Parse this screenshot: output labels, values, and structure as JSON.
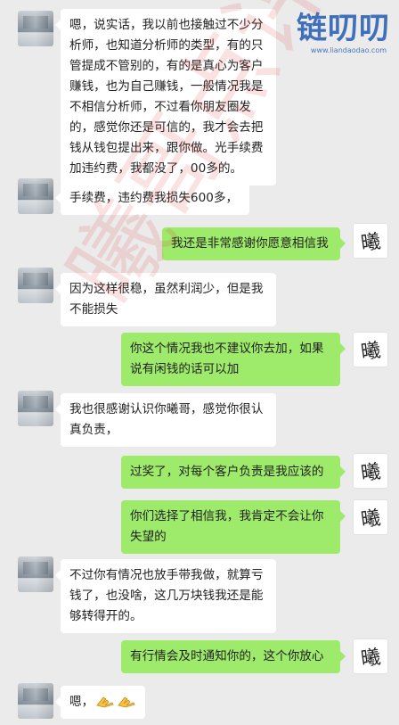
{
  "watermark": {
    "logo_text": "链叨叨",
    "logo_url": "www.liandaodao.com",
    "stamp_text": "曦哥点评"
  },
  "avatars": {
    "right_label": "曦"
  },
  "messages": [
    {
      "side": "left",
      "text": "嗯，说实话，我以前也接触过不少分析师，也知道分析师的类型，有的只管提成不管别的，有的是真心为客户赚钱，也为自己赚钱，一般情况我是不相信分析师，不过看你朋友圈发的，感觉你还是可信的，我才会去把钱从钱包提出来，跟你做。光手续费加违约费，我都没了，00多的。"
    },
    {
      "side": "left",
      "text": "手续费，违约费我损失600多，"
    },
    {
      "side": "right",
      "text": "我还是非常感谢你愿意相信我"
    },
    {
      "side": "left",
      "text": "因为这样很稳，虽然利润少，但是我不能损失"
    },
    {
      "side": "right",
      "text": "你这个情况我也不建议你去加，如果说有闲钱的话可以加"
    },
    {
      "side": "left",
      "text": "我也很感谢认识你曦哥，感觉你很认真负责，"
    },
    {
      "side": "right",
      "text": "过奖了，对每个客户负责是我应该的"
    },
    {
      "side": "right",
      "text": "你们选择了相信我，我肯定不会让你失望的"
    },
    {
      "side": "left",
      "text": "不过你有情况也放手带我做，就算亏钱了，也没啥，这几万块钱我还是能够转得开的。"
    },
    {
      "side": "right",
      "text": "有行情会及时通知你的，这个你放心"
    },
    {
      "side": "left",
      "text": "嗯，",
      "emoji": [
        "clap-hands-emoji",
        "clap-hands-emoji"
      ]
    }
  ]
}
